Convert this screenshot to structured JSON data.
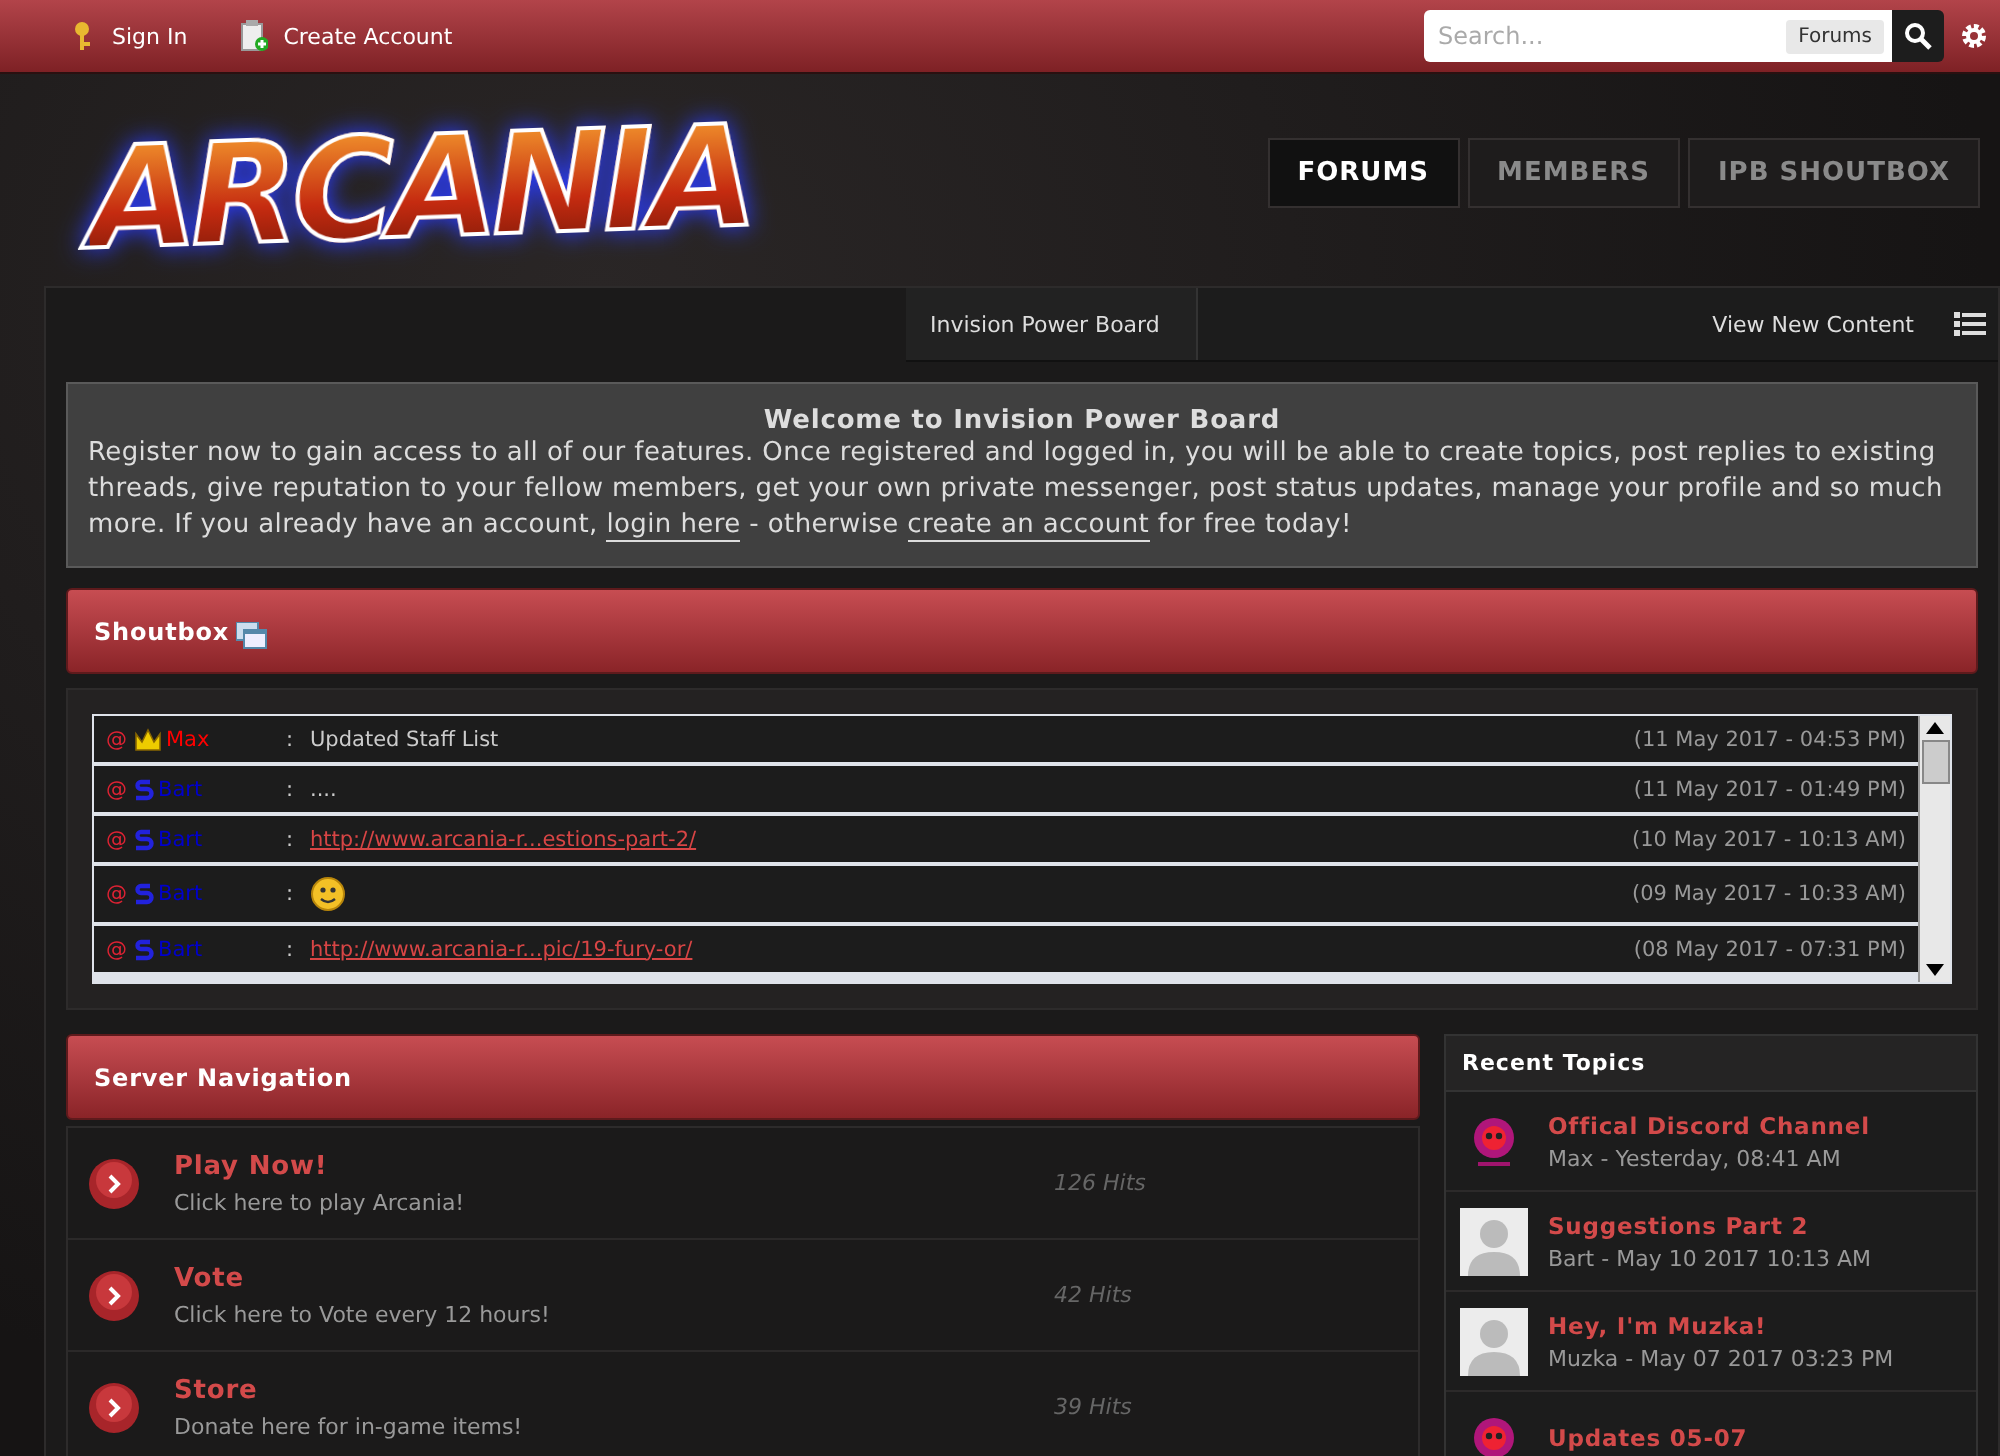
{
  "top_bar": {
    "links": [
      {
        "label": "Sign In",
        "kind": "signin"
      },
      {
        "label": "Create Account",
        "kind": "register"
      }
    ],
    "search": {
      "placeholder": "Search...",
      "scope": "Forums"
    }
  },
  "logo": {
    "text": "ARCANIA"
  },
  "nav_tabs": [
    {
      "label": "FORUMS",
      "selected": true
    },
    {
      "label": "MEMBERS",
      "selected": false
    },
    {
      "label": "IPB SHOUTBOX",
      "selected": false
    }
  ],
  "breadcrumb": {
    "items": [
      "Invision Power Board"
    ],
    "right_link": "View New Content"
  },
  "welcome": {
    "title": "Welcome to Invision Power Board",
    "parts": [
      {
        "kind": "text",
        "text": "Register now to gain access to all of our features. Once registered and logged in, you will be able to create topics, post replies to existing threads, give reputation to your fellow members, get your own private messenger, post status updates, manage your profile and so much more. If you already have an account, "
      },
      {
        "kind": "link",
        "text": "login here"
      },
      {
        "kind": "text",
        "text": " - otherwise "
      },
      {
        "kind": "link",
        "text": "create an account"
      },
      {
        "kind": "text",
        "text": " for free today!"
      }
    ]
  },
  "shoutbox": {
    "title": "Shoutbox",
    "shouts": [
      {
        "kind": "admin",
        "at": "@",
        "name": "Max",
        "color": "#ff0000",
        "separator": ":",
        "message": "Updated Staff List",
        "link": false,
        "time": "(11 May 2017 - 04:53 PM)"
      },
      {
        "kind": "staff",
        "at": "@",
        "name": "Bart",
        "color": "#0000cc",
        "separator": ":",
        "message": "....",
        "link": false,
        "time": "(11 May 2017 - 01:49 PM)"
      },
      {
        "kind": "staff",
        "at": "@",
        "name": "Bart",
        "color": "#0000cc",
        "separator": ":",
        "message": "http://www.arcania-r...estions-part-2/",
        "link": true,
        "time": "(10 May 2017 - 10:13 AM)"
      },
      {
        "kind": "staff",
        "at": "@",
        "name": "Bart",
        "color": "#0000cc",
        "separator": ":",
        "emoji": true,
        "time": "(09 May 2017 - 10:33 AM)"
      },
      {
        "kind": "staff",
        "at": "@",
        "name": "Bart",
        "color": "#0000cc",
        "separator": ":",
        "message": "http://www.arcania-r...pic/19-fury-or/",
        "link": true,
        "time": "(08 May 2017 - 07:31 PM)"
      }
    ]
  },
  "server_navigation": {
    "title": "Server Navigation",
    "items": [
      {
        "title": "Play Now!",
        "description": "Click here to play Arcania!",
        "hits": "126 Hits"
      },
      {
        "title": "Vote",
        "description": "Click here to Vote every 12 hours!",
        "hits": "42 Hits"
      },
      {
        "title": "Store",
        "description": "Donate here for in-game items!",
        "hits": "39 Hits"
      }
    ]
  },
  "recent_topics": {
    "title": "Recent Topics",
    "topics": [
      {
        "kind": "logo",
        "title": "Offical Discord Channel",
        "meta": "Max - Yesterday, 08:41 AM"
      },
      {
        "kind": "silhouette",
        "title": "Suggestions Part 2",
        "meta": "Bart - May 10 2017 10:13 AM"
      },
      {
        "kind": "silhouette",
        "title": "Hey, I'm Muzka!",
        "meta": "Muzka - May 07 2017 03:23 PM"
      },
      {
        "kind": "logo",
        "title": "Updates 05-07"
      }
    ]
  }
}
